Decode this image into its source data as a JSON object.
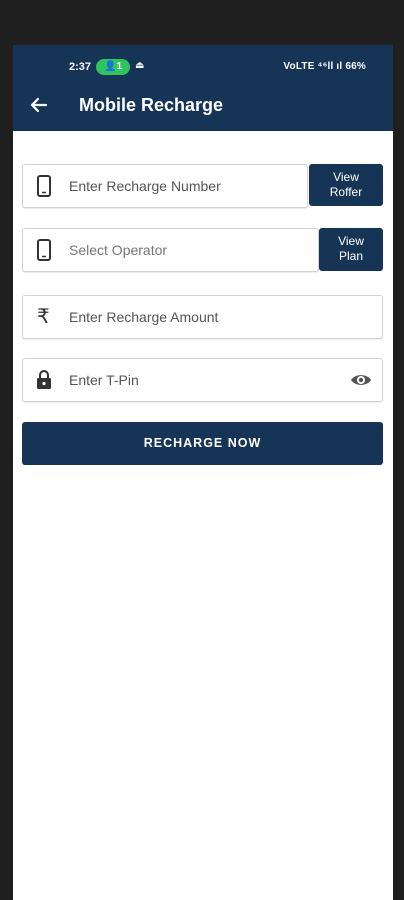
{
  "status_bar": {
    "time": "2:37",
    "call_badge": "1",
    "right_text": "VoLTE ⁴⁶ll ıl 66%"
  },
  "header": {
    "title": "Mobile Recharge"
  },
  "form": {
    "number_placeholder": "Enter Recharge Number",
    "view_roffer_line1": "View",
    "view_roffer_line2": "Roffer",
    "operator_placeholder": "Select Operator",
    "view_plan_line1": "View",
    "view_plan_line2": "Plan",
    "amount_placeholder": "Enter Recharge Amount",
    "rupee_symbol": "₹",
    "tpin_placeholder": "Enter T-Pin",
    "recharge_button": "RECHARGE NOW"
  },
  "colors": {
    "brand": "#163456",
    "badge": "#2fc45d"
  }
}
